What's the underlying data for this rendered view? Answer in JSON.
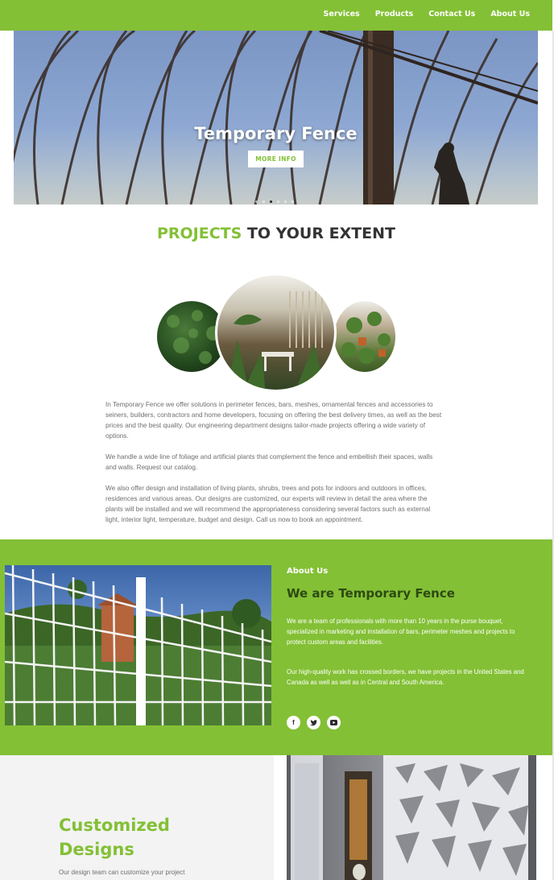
{
  "nav": {
    "items": [
      "Services",
      "Products",
      "Contact Us",
      "About Us"
    ]
  },
  "hero": {
    "title": "Temporary Fence",
    "button_label": "MORE INFO",
    "slides_count": 6,
    "active_slide": 3
  },
  "projects": {
    "title_green": "PROJECTS",
    "title_dark": "TO YOUR EXTENT",
    "paragraphs": [
      "In Temporary Fence we offer solutions in perimeter fences, bars, meshes, ornamental fences and accessories to seiners, builders, contractors and home developers, focusing on offering the best delivery times, as well as the best prices and the best quality. Our engineering department designs tailor-made projects offering a wide variety of options.",
      "We handle a wide line of foliage and artificial plants that complement the fence and embellish their spaces, walls and walls. Request our catalog.",
      "We also offer design and installation of living plants, shrubs, trees and pots for indoors and outdoors in offices, residences and various areas. Our designs are customized, our experts will review in detail the area where the plants will be installed and we will recommend the appropriateness considering several factors such as external light, interior light, temperature, budget and design. Call us now to book an appointment."
    ]
  },
  "about": {
    "kicker": "About Us",
    "title": "We are Temporary Fence",
    "p1": "We are a team of professionals with more than 10 years in the purse bouquet, specialized in marketing and installation of bars, perimeter meshes and projects to protect custom areas and facilities.",
    "p2": "Our high-quality work has crossed borders, we have projects in the United States and Canada as well as well as in Central and South America.",
    "social_icons": [
      "facebook-icon",
      "twitter-icon",
      "youtube-icon"
    ]
  },
  "custom": {
    "title": "Customized Designs",
    "text": "Our design team can customize your project"
  },
  "colors": {
    "brand_green": "#83c035",
    "dark_green": "#2d4a12",
    "text_gray": "#6f6f6f"
  }
}
